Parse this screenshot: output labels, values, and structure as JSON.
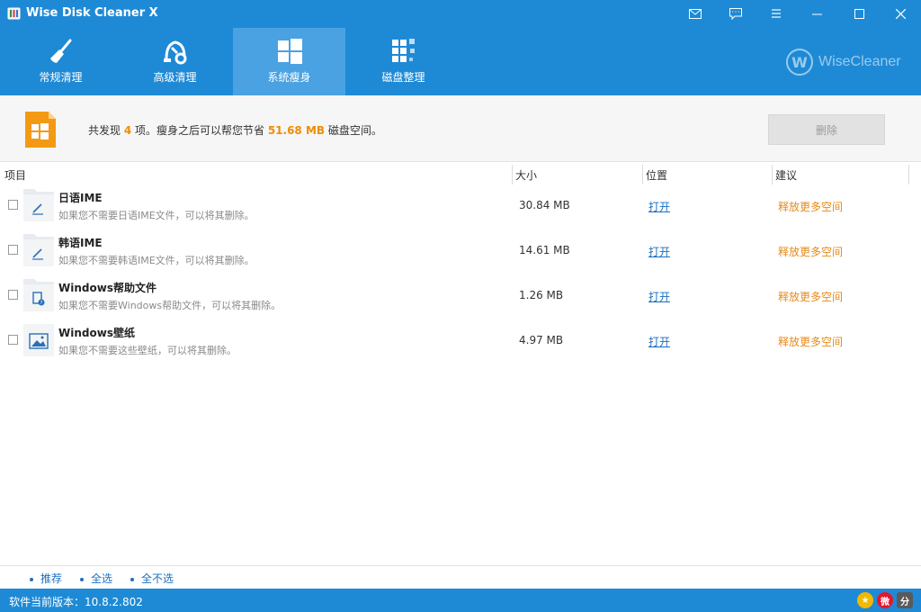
{
  "app": {
    "title": "Wise Disk Cleaner X",
    "icon": "app-disk-icon"
  },
  "window_controls": [
    {
      "name": "mail-icon"
    },
    {
      "name": "feedback-icon"
    },
    {
      "name": "menu-icon"
    },
    {
      "name": "minimize-icon"
    },
    {
      "name": "maximize-icon"
    },
    {
      "name": "close-icon"
    }
  ],
  "nav": {
    "tabs": [
      {
        "label": "常规清理",
        "icon": "broom-icon"
      },
      {
        "label": "高级清理",
        "icon": "vacuum-icon"
      },
      {
        "label": "系统瘦身",
        "icon": "windows-icon",
        "active": true
      },
      {
        "label": "磁盘整理",
        "icon": "defrag-icon"
      }
    ],
    "brand": "WiseCleaner",
    "brand_mark": "W"
  },
  "summary": {
    "prefix": "共发现 ",
    "count": "4",
    "middle": " 项。瘦身之后可以帮您节省 ",
    "size": "51.68 MB",
    "suffix": " 磁盘空间。",
    "delete_label": "删除"
  },
  "columns": {
    "item": "项目",
    "size": "大小",
    "location": "位置",
    "suggestion": "建议"
  },
  "rows": [
    {
      "title": "日语IME",
      "desc": "如果您不需要日语IME文件，可以将其删除。",
      "size": "30.84 MB",
      "open": "打开",
      "suggest": "释放更多空间",
      "icon": "pen-file-icon"
    },
    {
      "title": "韩语IME",
      "desc": "如果您不需要韩语IME文件，可以将其删除。",
      "size": "14.61 MB",
      "open": "打开",
      "suggest": "释放更多空间",
      "icon": "pen-file-icon"
    },
    {
      "title": "Windows帮助文件",
      "desc": "如果您不需要Windows帮助文件，可以将其删除。",
      "size": "1.26 MB",
      "open": "打开",
      "suggest": "释放更多空间",
      "icon": "help-file-icon"
    },
    {
      "title": "Windows壁纸",
      "desc": "如果您不需要这些壁纸，可以将其删除。",
      "size": "4.97 MB",
      "open": "打开",
      "suggest": "释放更多空间",
      "icon": "wallpaper-icon"
    }
  ],
  "bottom": {
    "recommend": "推荐",
    "select_all": "全选",
    "select_none": "全不选"
  },
  "status": {
    "version_text": "软件当前版本：10.8.2.802"
  },
  "colors": {
    "accent": "#1e8ad6",
    "highlight": "#f08c00",
    "link": "#1b6fc2"
  }
}
